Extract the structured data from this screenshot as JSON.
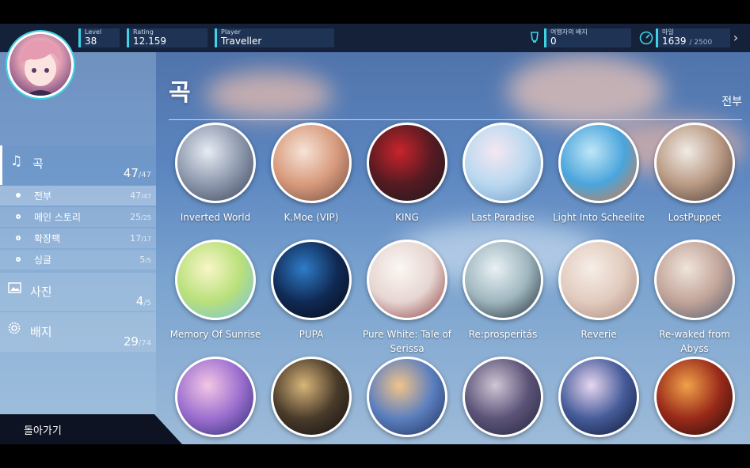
{
  "hud": {
    "level_label": "Level",
    "level_value": "38",
    "rating_label": "Rating",
    "rating_value": "12.159",
    "player_label": "Player",
    "player_value": "Traveller",
    "badge_label": "여행자의 배지",
    "badge_value": "0",
    "stamina_label": "마일",
    "stamina_value": "1639",
    "stamina_max": "/ 2500"
  },
  "sidebar": {
    "songs": {
      "label": "곡",
      "count": "47",
      "total": "/47"
    },
    "subitems": [
      {
        "label": "전부",
        "count": "47",
        "total": "/47",
        "selected": true
      },
      {
        "label": "메인 스토리",
        "count": "25",
        "total": "/25",
        "selected": false
      },
      {
        "label": "확장팩",
        "count": "17",
        "total": "/17",
        "selected": false
      },
      {
        "label": "싱글",
        "count": "5",
        "total": "/5",
        "selected": false
      }
    ],
    "photos": {
      "label": "사진",
      "count": "4",
      "total": "/5"
    },
    "badges": {
      "label": "배지",
      "count": "29",
      "total": "/74"
    },
    "back_label": "돌아가기"
  },
  "main": {
    "title": "곡",
    "filter": "전부",
    "songs": [
      {
        "title": "Inverted World",
        "colors": [
          "#e7ecf3",
          "#8d98ad",
          "#3b4258"
        ]
      },
      {
        "title": "K.Moe (VIP)",
        "colors": [
          "#f7e3d6",
          "#d79a7c",
          "#6e4a3e"
        ]
      },
      {
        "title": "KING",
        "colors": [
          "#c9242b",
          "#551a22",
          "#1a1a1f"
        ]
      },
      {
        "title": "Last Paradise",
        "colors": [
          "#f4e8f2",
          "#b9d8ef",
          "#6f9bc8"
        ]
      },
      {
        "title": "Light Into Scheelite",
        "colors": [
          "#bfe6f7",
          "#4aa5dc",
          "#e0763b"
        ]
      },
      {
        "title": "LostPuppet",
        "colors": [
          "#f1ece6",
          "#b99a84",
          "#4a3a34"
        ]
      },
      {
        "title": "Memory Of Sunrise",
        "colors": [
          "#f8f6c8",
          "#b9e07a",
          "#6fc1e5"
        ]
      },
      {
        "title": "PUPA",
        "colors": [
          "#2f7cc8",
          "#102a55",
          "#050914"
        ]
      },
      {
        "title": "Pure White: Tale of Serissa",
        "colors": [
          "#fbf7f3",
          "#e6d6d2",
          "#8a3a3a"
        ]
      },
      {
        "title": "Re:prosperitás",
        "colors": [
          "#e9f1f4",
          "#9fb6bf",
          "#1d2a33"
        ]
      },
      {
        "title": "Reverie",
        "colors": [
          "#f6eee7",
          "#e2cbbf",
          "#a98878"
        ]
      },
      {
        "title": "Re-waked from Abyss",
        "colors": [
          "#f0e4db",
          "#c2a59a",
          "#4f5a6e"
        ]
      },
      {
        "title": "",
        "colors": [
          "#f3c6e4",
          "#9c6fd0",
          "#2a2a6e"
        ]
      },
      {
        "title": "",
        "colors": [
          "#d8b67a",
          "#4a3b2a",
          "#0d0c0f"
        ]
      },
      {
        "title": "",
        "colors": [
          "#f2c38a",
          "#5b7fbf",
          "#1d2c55"
        ]
      },
      {
        "title": "",
        "colors": [
          "#d0c6d6",
          "#5c5478",
          "#20213a"
        ]
      },
      {
        "title": "",
        "colors": [
          "#e7d6f0",
          "#465c9a",
          "#0b1530"
        ]
      },
      {
        "title": "",
        "colors": [
          "#f0a24a",
          "#9a2a1a",
          "#1e0d0a"
        ]
      }
    ]
  },
  "theme": {
    "accent": "#3fd3e6"
  }
}
